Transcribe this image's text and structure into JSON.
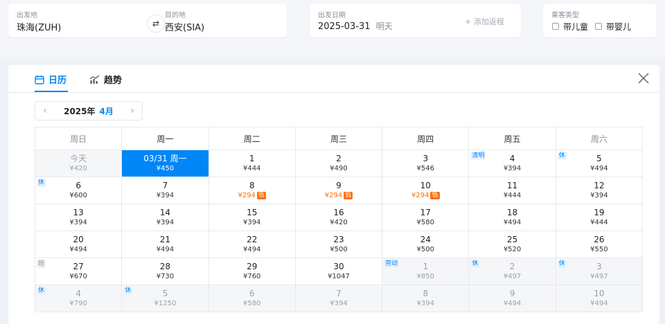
{
  "search": {
    "depart_label": "出发地",
    "depart_value": "珠海(ZUH)",
    "dest_label": "目的地",
    "dest_value": "西安(SIA)",
    "swap_icon": "⇄",
    "date_label": "出发日期",
    "date_value": "2025-03-31",
    "date_note": "明天",
    "add_return": "+ 添加返程",
    "passenger_label": "乘客类型",
    "child_label": "带儿童",
    "infant_label": "带婴儿"
  },
  "panel": {
    "tab_calendar": "日历",
    "tab_trend": "趋势",
    "year": "2025年",
    "month": "4月",
    "prev_icon": "‹",
    "next_icon": "›",
    "low_badge": "低"
  },
  "calendar": {
    "weekdays": [
      "周日",
      "周一",
      "周二",
      "周三",
      "周四",
      "周五",
      "周六"
    ],
    "weeks": [
      [
        {
          "day": "今天",
          "price": "¥420",
          "state": "past"
        },
        {
          "day": "03/31 周一",
          "price": "¥450",
          "state": "selected"
        },
        {
          "day": "1",
          "price": "¥444"
        },
        {
          "day": "2",
          "price": "¥490"
        },
        {
          "day": "3",
          "price": "¥546"
        },
        {
          "day": "4",
          "price": "¥394",
          "tag": "清明"
        },
        {
          "day": "5",
          "price": "¥494",
          "tag": "休"
        }
      ],
      [
        {
          "day": "6",
          "price": "¥600",
          "tag": "休"
        },
        {
          "day": "7",
          "price": "¥394"
        },
        {
          "day": "8",
          "price": "¥294",
          "low": true
        },
        {
          "day": "9",
          "price": "¥294",
          "low": true
        },
        {
          "day": "10",
          "price": "¥294",
          "low": true
        },
        {
          "day": "11",
          "price": "¥444"
        },
        {
          "day": "12",
          "price": "¥394"
        }
      ],
      [
        {
          "day": "13",
          "price": "¥394"
        },
        {
          "day": "14",
          "price": "¥394"
        },
        {
          "day": "15",
          "price": "¥394"
        },
        {
          "day": "16",
          "price": "¥420"
        },
        {
          "day": "17",
          "price": "¥580"
        },
        {
          "day": "18",
          "price": "¥494"
        },
        {
          "day": "19",
          "price": "¥444"
        }
      ],
      [
        {
          "day": "20",
          "price": "¥494"
        },
        {
          "day": "21",
          "price": "¥494"
        },
        {
          "day": "22",
          "price": "¥494"
        },
        {
          "day": "23",
          "price": "¥500"
        },
        {
          "day": "24",
          "price": "¥500"
        },
        {
          "day": "25",
          "price": "¥520"
        },
        {
          "day": "26",
          "price": "¥550"
        }
      ],
      [
        {
          "day": "27",
          "price": "¥670",
          "tag": "班",
          "tag_type": "work"
        },
        {
          "day": "28",
          "price": "¥730"
        },
        {
          "day": "29",
          "price": "¥760"
        },
        {
          "day": "30",
          "price": "¥1047"
        },
        {
          "day": "1",
          "price": "¥850",
          "tag": "劳动",
          "state": "next"
        },
        {
          "day": "2",
          "price": "¥497",
          "tag": "休",
          "state": "next"
        },
        {
          "day": "3",
          "price": "¥497",
          "tag": "休",
          "state": "next"
        }
      ],
      [
        {
          "day": "4",
          "price": "¥790",
          "tag": "休",
          "state": "next"
        },
        {
          "day": "5",
          "price": "¥1250",
          "tag": "休",
          "state": "next"
        },
        {
          "day": "6",
          "price": "¥580",
          "state": "next"
        },
        {
          "day": "7",
          "price": "¥394",
          "state": "next"
        },
        {
          "day": "8",
          "price": "¥394",
          "state": "next"
        },
        {
          "day": "9",
          "price": "¥494",
          "state": "next"
        },
        {
          "day": "10",
          "price": "¥494",
          "state": "next"
        }
      ]
    ]
  },
  "colors": {
    "accent": "#0086f6",
    "low_price": "#ff6f00",
    "holiday_tag_bg": "#e8f3ff"
  }
}
